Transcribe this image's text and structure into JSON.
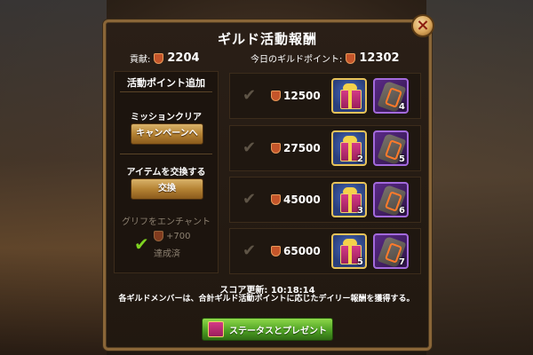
{
  "window": {
    "title": "ギルド活動報酬"
  },
  "stats": {
    "contribution_label": "貢献:",
    "contribution_value": "2204",
    "today_label": "今日のギルドポイント:",
    "today_value": "12302"
  },
  "left_panel": {
    "heading": "活動ポイント追加",
    "mission_label": "ミッションクリア",
    "campaign_button": "キャンペーンへ",
    "exchange_label": "アイテムを交換する",
    "exchange_button": "交換",
    "glyph_label": "グリフをエンチャント",
    "glyph_points": "+700",
    "glyph_status": "達成済"
  },
  "rewards": [
    {
      "points": "12500",
      "gift_count": "",
      "glyph_count": "4"
    },
    {
      "points": "27500",
      "gift_count": "2",
      "glyph_count": "5"
    },
    {
      "points": "45000",
      "gift_count": "3",
      "glyph_count": "6"
    },
    {
      "points": "65000",
      "gift_count": "5",
      "glyph_count": "7"
    }
  ],
  "footer": {
    "score_update": "スコア更新: 10:18:14",
    "description": "各ギルドメンバーは、合計ギルド活動ポイントに応じたデイリー報酬を獲得する。",
    "status_button": "ステータスとプレゼント"
  },
  "colors": {
    "panel_border": "#8a6638",
    "gold_button": "#b58334",
    "green_button": "#4fa224",
    "check_green": "#7ed321"
  },
  "icons": [
    "close-icon",
    "guild-point-shield-icon",
    "checkmark-icon",
    "gift-box-icon",
    "glyph-stone-icon"
  ]
}
